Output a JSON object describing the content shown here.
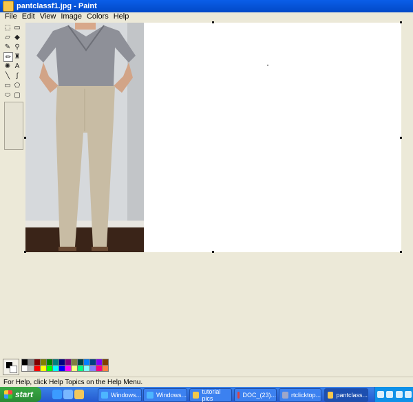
{
  "window": {
    "title": "pantclassf1.jpg - Paint"
  },
  "menu": [
    "File",
    "Edit",
    "View",
    "Image",
    "Colors",
    "Help"
  ],
  "tools": [
    {
      "name": "free-select-icon",
      "glyph": "⬚"
    },
    {
      "name": "select-icon",
      "glyph": "▭"
    },
    {
      "name": "eraser-icon",
      "glyph": "▱"
    },
    {
      "name": "fill-icon",
      "glyph": "◆"
    },
    {
      "name": "pick-color-icon",
      "glyph": "✎"
    },
    {
      "name": "magnifier-icon",
      "glyph": "⚲"
    },
    {
      "name": "pencil-icon",
      "glyph": "✏"
    },
    {
      "name": "brush-icon",
      "glyph": "♜"
    },
    {
      "name": "airbrush-icon",
      "glyph": "✺"
    },
    {
      "name": "text-icon",
      "glyph": "A"
    },
    {
      "name": "line-icon",
      "glyph": "╲"
    },
    {
      "name": "curve-icon",
      "glyph": "∫"
    },
    {
      "name": "rectangle-icon",
      "glyph": "▭"
    },
    {
      "name": "polygon-icon",
      "glyph": "⬠"
    },
    {
      "name": "ellipse-icon",
      "glyph": "⬭"
    },
    {
      "name": "rounded-rectangle-icon",
      "glyph": "▢"
    }
  ],
  "active_tool_index": 6,
  "palette": [
    "#000000",
    "#808080",
    "#800000",
    "#808000",
    "#008000",
    "#008080",
    "#000080",
    "#800080",
    "#808040",
    "#004040",
    "#0080ff",
    "#004080",
    "#8000ff",
    "#804000",
    "#ffffff",
    "#c0c0c0",
    "#ff0000",
    "#ffff00",
    "#00ff00",
    "#00ffff",
    "#0000ff",
    "#ff00ff",
    "#ffff80",
    "#00ff80",
    "#80ffff",
    "#8080ff",
    "#ff0080",
    "#ff8040"
  ],
  "status": {
    "text": "For Help, click Help Topics on the Help Menu."
  },
  "taskbar": {
    "start_label": "start",
    "tasks": [
      {
        "label": "Windows...",
        "color": "#4db6ff"
      },
      {
        "label": "Windows...",
        "color": "#4db6ff"
      },
      {
        "label": "tutorial pics",
        "color": "#f2c94c"
      },
      {
        "label": "DOC_(23)...",
        "color": "#e04040"
      },
      {
        "label": "rtclicktop...",
        "color": "#9ea7c9"
      },
      {
        "label": "pantclass...",
        "color": "#f6c74d"
      }
    ]
  }
}
